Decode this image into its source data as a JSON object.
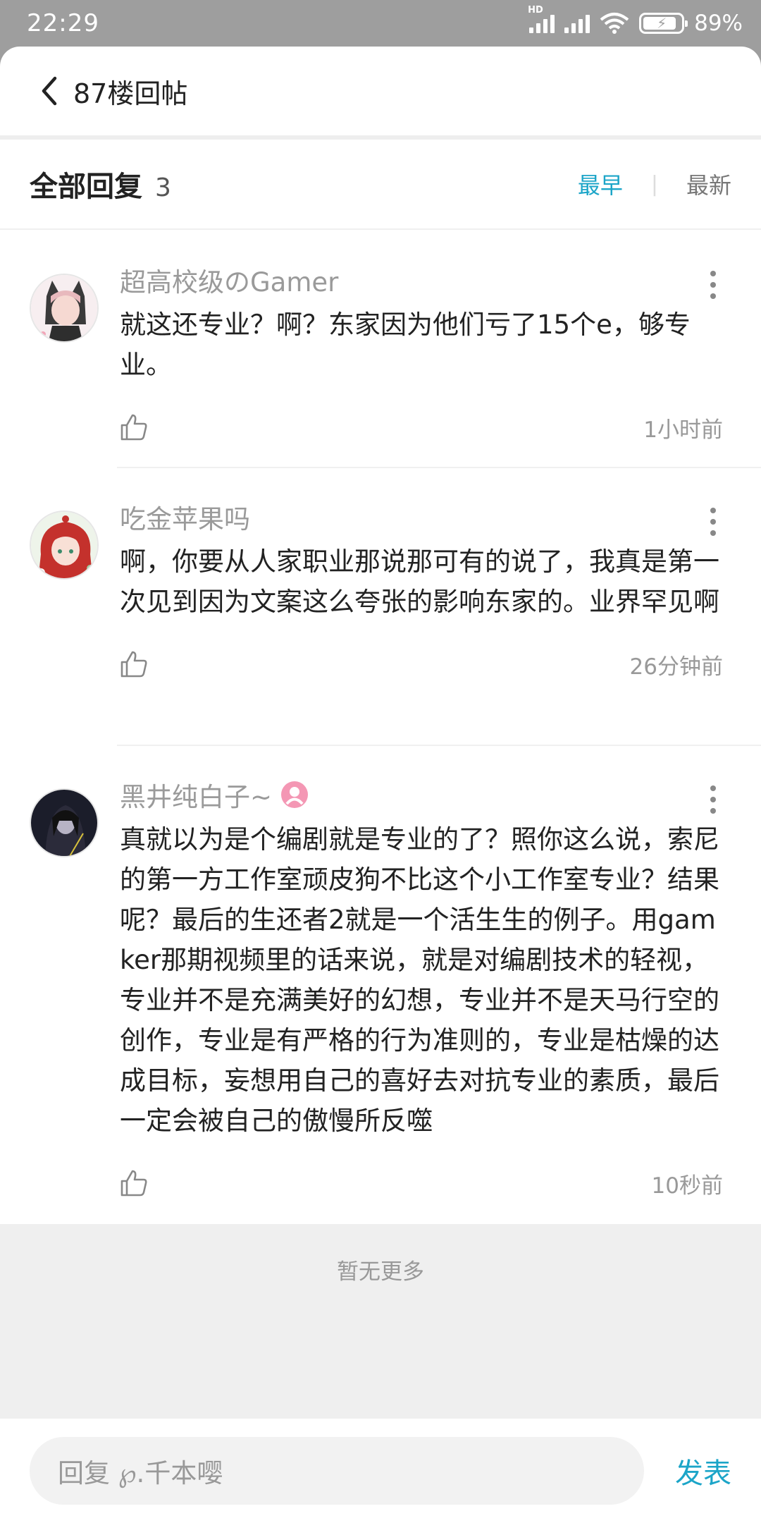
{
  "status_bar": {
    "time": "22:29",
    "network_label": "HD",
    "battery": "89%"
  },
  "header": {
    "title": "87楼回帖"
  },
  "reply_section": {
    "title": "全部回复",
    "count": "3",
    "sort_earliest": "最早",
    "sort_latest": "最新",
    "active_sort": "最早"
  },
  "comments": [
    {
      "user": "超高校级のGamer",
      "text": "就这还专业？啊？东家因为他们亏了15个e，够专业。",
      "time": "1小时前"
    },
    {
      "user": "吃金苹果吗",
      "text": "啊，你要从人家职业那说那可有的说了，我真是第一次见到因为文案这么夸张的影响东家的。业界罕见啊",
      "time": "26分钟前"
    },
    {
      "user": "黑井纯白子~",
      "text": "真就以为是个编剧就是专业的了？照你这么说，索尼的第一方工作室顽皮狗不比这个小工作室专业？结果呢？最后的生还者2就是一个活生生的例子。用gamker那期视频里的话来说，就是对编剧技术的轻视，专业并不是充满美好的幻想，专业并不是天马行空的创作，专业是有严格的行为准则的，专业是枯燥的达成目标，妄想用自己的喜好去对抗专业的素质，最后一定会被自己的傲慢所反噬",
      "time": "10秒前"
    }
  ],
  "no_more": "暂无更多",
  "footer": {
    "input_placeholder": "回复 ℘.千本嘤",
    "send_label": "发表"
  },
  "colors": {
    "accent": "#1ca5c8",
    "status_bar": "#9e9e9e",
    "muted_text": "#999999"
  }
}
